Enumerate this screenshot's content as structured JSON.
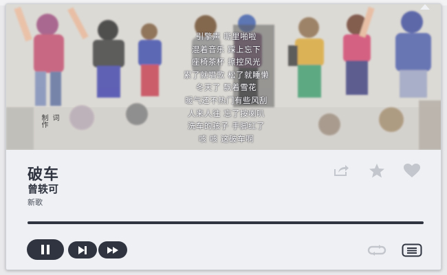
{
  "song": {
    "title": "破车",
    "artist": "曾轶可",
    "album": "新歌"
  },
  "artwork": {
    "lyrics": [
      "引擎声 嘶里啪啦",
      "混着音乐 踩上忘下",
      "座椅茶杯 擦控风光",
      "累了就唱歌 松了就睡懒",
      "冬天了 飘着雪花",
      "暖气还不热门有些风刮",
      "人来人往 忘了按喇叭",
      "洗车的孩子 手脚红了",
      "咳 咳 这破车啊"
    ],
    "credit_left": "制作",
    "credit_right": "词"
  },
  "playback": {
    "progress": 1.0,
    "state": "playing"
  },
  "icons": {
    "share": "share-icon",
    "star": "star-icon",
    "heart": "heart-icon",
    "pause": "pause-icon",
    "next": "next-track-icon",
    "fast_forward": "fast-forward-icon",
    "loop": "loop-icon",
    "playlist": "playlist-icon"
  },
  "colors": {
    "primary": "#2f3440",
    "icon_muted": "#c3c6cc",
    "panel": "#eef0f3"
  }
}
